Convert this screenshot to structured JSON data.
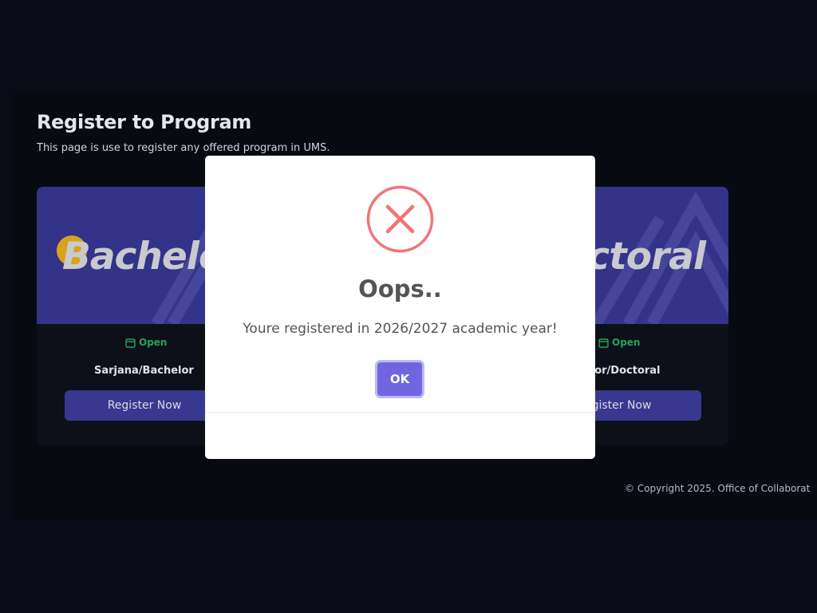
{
  "page": {
    "title": "Register to Program",
    "subtitle": "This page is use to register any offered program in UMS."
  },
  "cards": [
    {
      "banner_text": "Bachelo",
      "status": "Open",
      "program": "Sarjana/Bachelor",
      "button_label": "Register Now"
    },
    {
      "banner_text": "ctoral",
      "status": "Open",
      "program": "tor/Doctoral",
      "button_label": "gister Now"
    }
  ],
  "footer": {
    "text": "© Copyright 2025. Office of Collaborat"
  },
  "modal": {
    "icon": "error-x-icon",
    "title": "Oops..",
    "message": "Youre registered in 2026/2027 academic year!",
    "ok_label": "OK"
  },
  "colors": {
    "background": "#0b0b18",
    "banner": "#33338a",
    "primary_button": "#383890",
    "status_open": "#22a55a",
    "error": "#f27474",
    "modal_confirm": "#7066e0"
  }
}
